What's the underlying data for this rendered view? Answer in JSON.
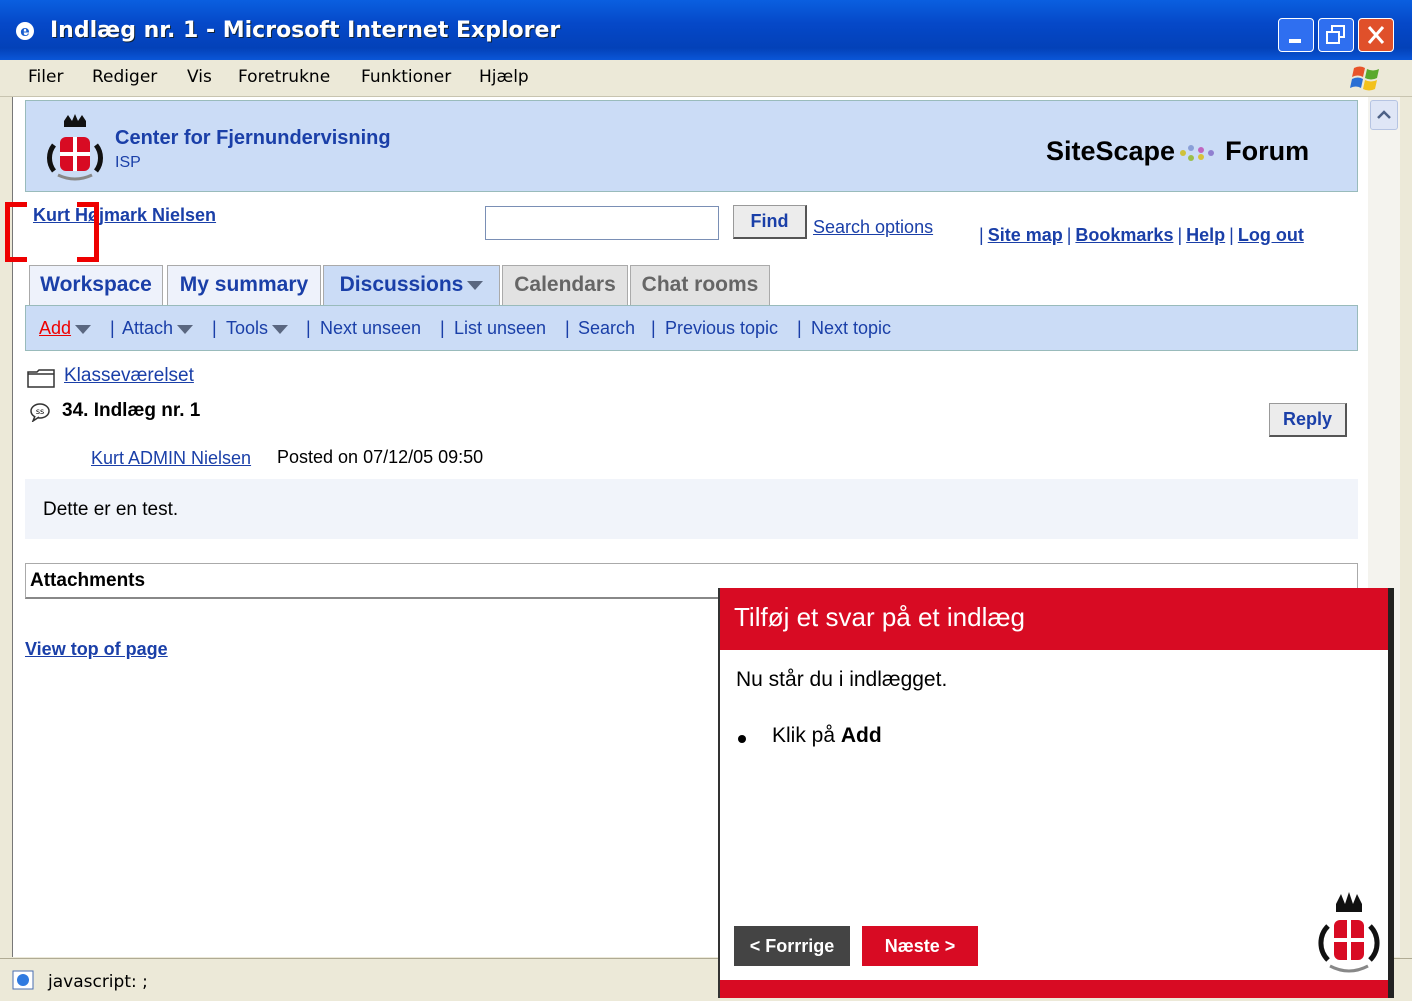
{
  "window": {
    "title": "Indlæg nr. 1 - Microsoft Internet Explorer"
  },
  "menu": [
    "Filer",
    "Rediger",
    "Vis",
    "Foretrukne",
    "Funktioner",
    "Hjælp"
  ],
  "banner": {
    "org": "Center for Fjernundervisning",
    "sub": "ISP",
    "brand_left": "SiteScape",
    "brand_right": "Forum"
  },
  "header": {
    "user": "Kurt Højmark Nielsen",
    "search_value": "",
    "find_label": "Find",
    "search_options": "Search options",
    "links": [
      "Site map",
      "Bookmarks",
      "Help",
      "Log out"
    ]
  },
  "tabs": [
    "Workspace",
    "My summary",
    "Discussions",
    "Calendars",
    "Chat rooms"
  ],
  "toolbar": {
    "add": "Add",
    "attach": "Attach",
    "tools": "Tools",
    "next_unseen": "Next unseen",
    "list_unseen": "List unseen",
    "search": "Search",
    "previous_topic": "Previous topic",
    "next_topic": "Next topic"
  },
  "topic": {
    "folder": "Klasseværelset",
    "title": "34. Indlæg nr. 1",
    "reply": "Reply",
    "author": "Kurt ADMIN Nielsen",
    "posted": "Posted on 07/12/05 09:50",
    "body": "Dette er en test.",
    "attachments": "Attachments",
    "view_top": "View top of page"
  },
  "status": {
    "text": "javascript: ;"
  },
  "popup": {
    "title": "Tilføj et svar på et indlæg",
    "text": "Nu står du i indlægget.",
    "bullet_prefix": "Klik på ",
    "bullet_bold": "Add",
    "prev": "< Forrrige",
    "next": "Næste >"
  },
  "colors": {
    "accent_red": "#d80b23",
    "link_blue": "#1a3fa8",
    "banner_bg": "#cbdcf6"
  }
}
